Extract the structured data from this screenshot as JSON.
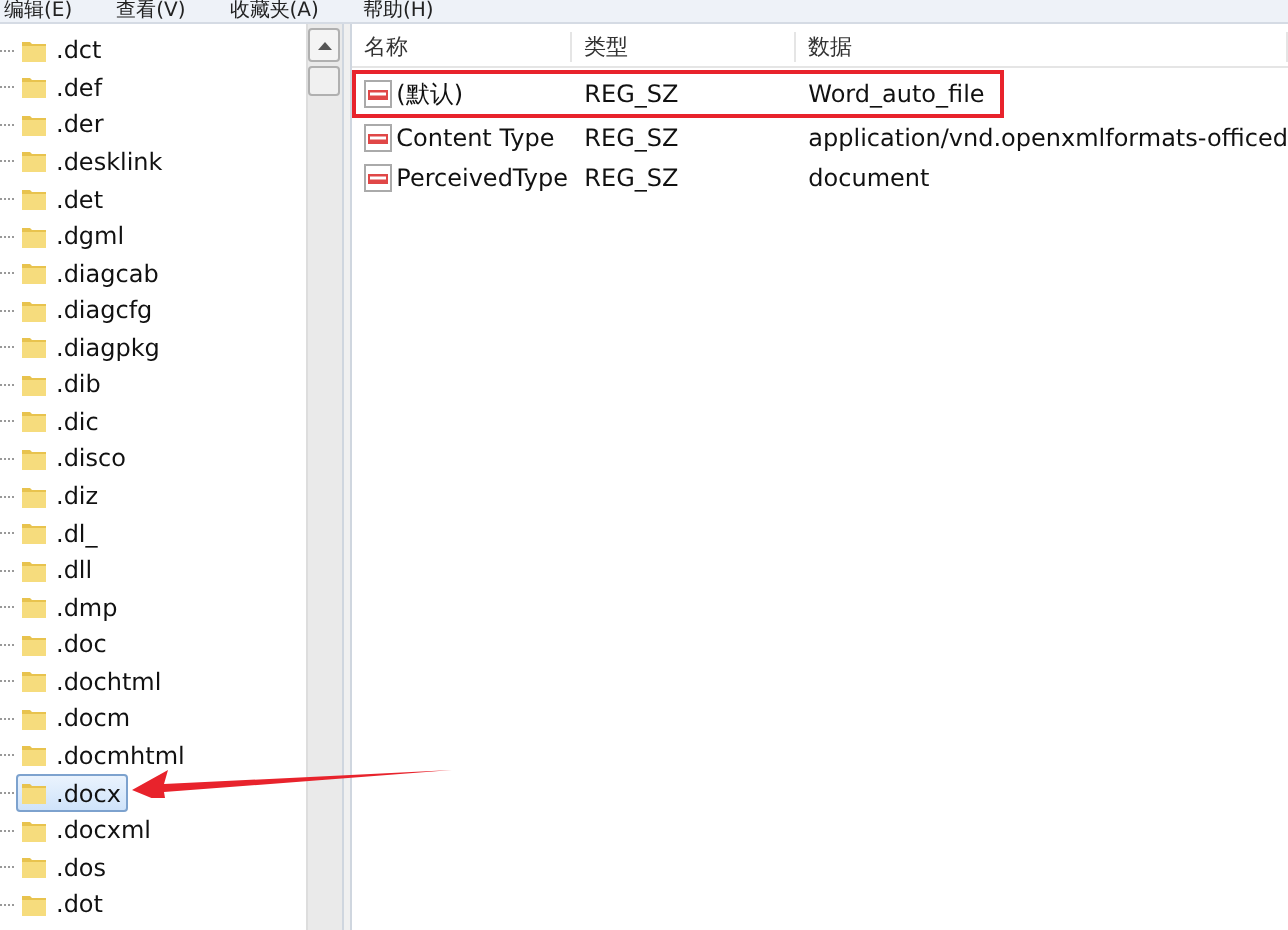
{
  "menu": [
    "编辑(E)",
    "查看(V)",
    "收藏夹(A)",
    "帮助(H)"
  ],
  "tree": [
    {
      "label": ".dct",
      "selected": false
    },
    {
      "label": ".def",
      "selected": false
    },
    {
      "label": ".der",
      "selected": false
    },
    {
      "label": ".desklink",
      "selected": false
    },
    {
      "label": ".det",
      "selected": false
    },
    {
      "label": ".dgml",
      "selected": false
    },
    {
      "label": ".diagcab",
      "selected": false
    },
    {
      "label": ".diagcfg",
      "selected": false
    },
    {
      "label": ".diagpkg",
      "selected": false
    },
    {
      "label": ".dib",
      "selected": false
    },
    {
      "label": ".dic",
      "selected": false
    },
    {
      "label": ".disco",
      "selected": false
    },
    {
      "label": ".diz",
      "selected": false
    },
    {
      "label": ".dl_",
      "selected": false
    },
    {
      "label": ".dll",
      "selected": false
    },
    {
      "label": ".dmp",
      "selected": false
    },
    {
      "label": ".doc",
      "selected": false
    },
    {
      "label": ".dochtml",
      "selected": false
    },
    {
      "label": ".docm",
      "selected": false
    },
    {
      "label": ".docmhtml",
      "selected": false
    },
    {
      "label": ".docx",
      "selected": true
    },
    {
      "label": ".docxml",
      "selected": false
    },
    {
      "label": ".dos",
      "selected": false
    },
    {
      "label": ".dot",
      "selected": false
    }
  ],
  "values": {
    "columns": [
      "名称",
      "类型",
      "数据"
    ],
    "rows": [
      {
        "name": "(默认)",
        "type": "REG_SZ",
        "data": "Word_auto_file",
        "highlighted": true
      },
      {
        "name": "Content Type",
        "type": "REG_SZ",
        "data": "application/vnd.openxmlformats-officed",
        "highlighted": false
      },
      {
        "name": "PerceivedType",
        "type": "REG_SZ",
        "data": "document",
        "highlighted": false
      }
    ]
  }
}
